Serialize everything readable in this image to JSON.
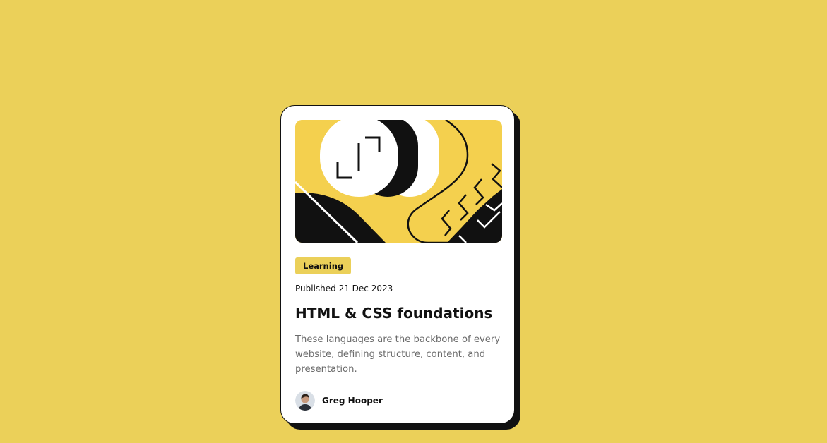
{
  "card": {
    "tag": "Learning",
    "published": "Published 21 Dec 2023",
    "title": "HTML & CSS foundations",
    "description": "These languages are the backbone of every website, defining structure, content, and presentation.",
    "author": {
      "name": "Greg Hooper",
      "avatar_icon": "avatar-photo-icon"
    },
    "hero_icon": "abstract-illustration"
  },
  "colors": {
    "page_background": "#ebd059",
    "card_background": "#ffffff",
    "card_shadow": "#111111",
    "tag_background": "#ebd059",
    "text_primary": "#111111",
    "text_secondary": "#6b6b6b"
  }
}
